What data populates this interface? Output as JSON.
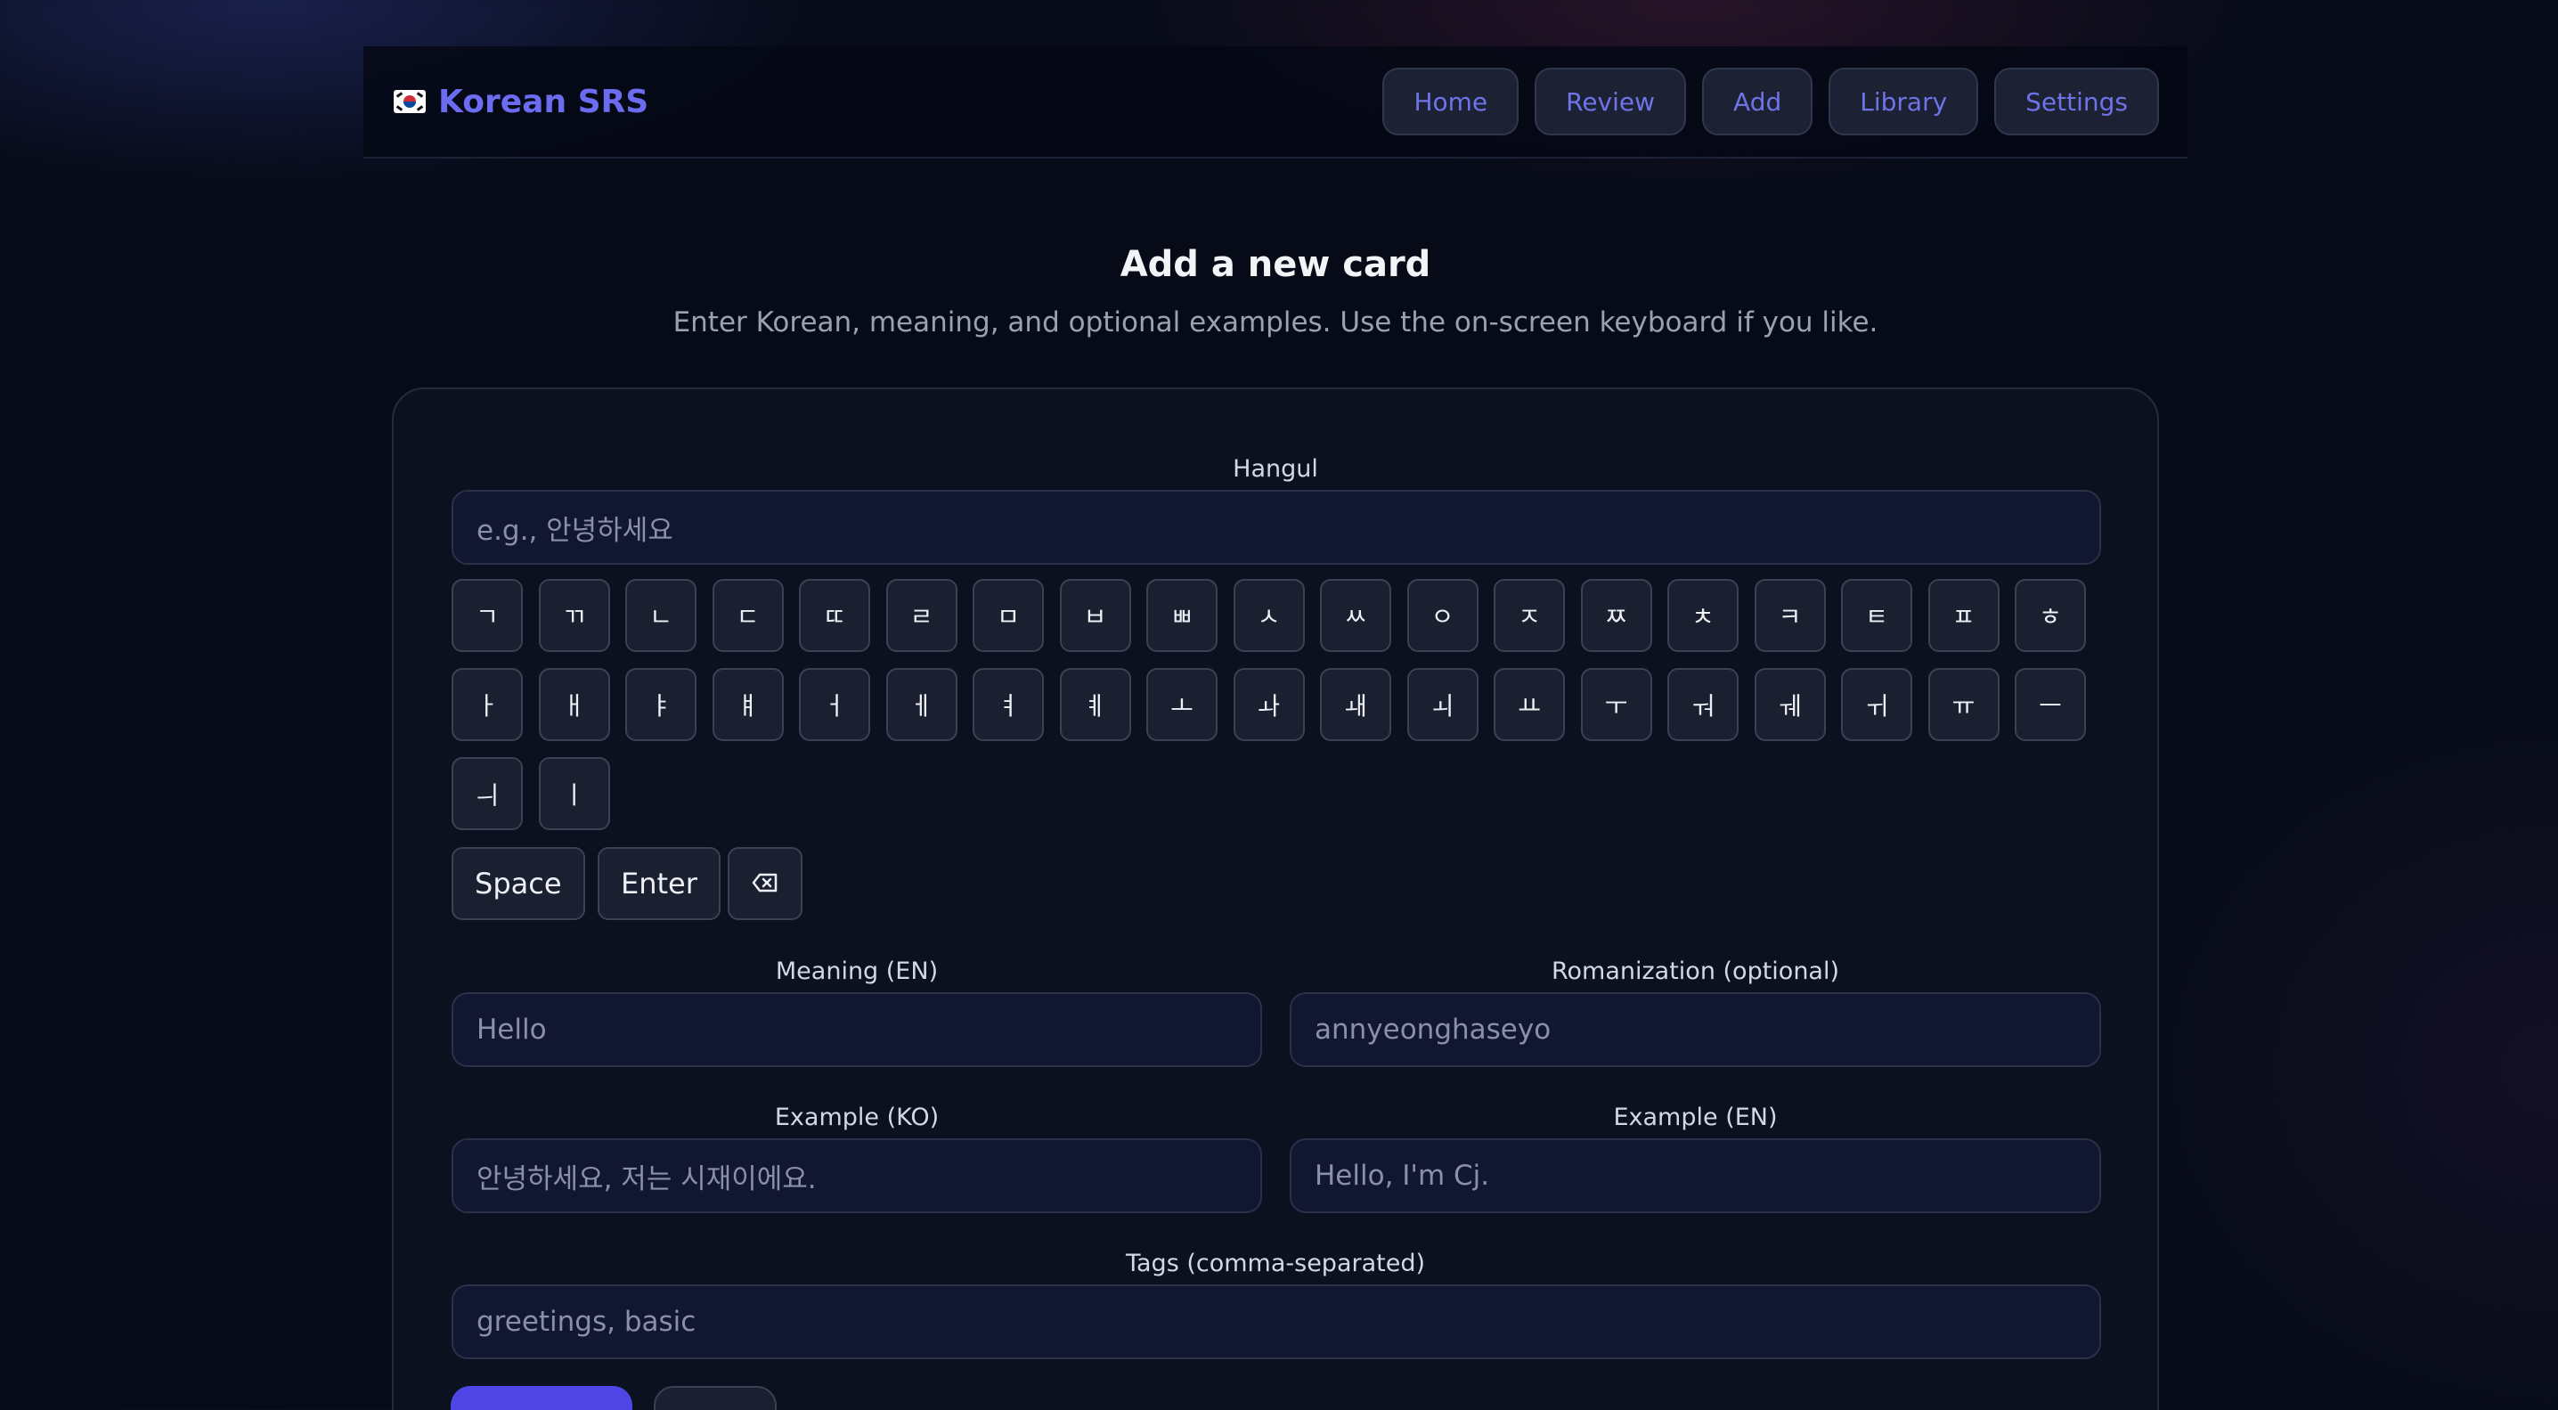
{
  "nav": {
    "brand": "Korean SRS",
    "links": [
      "Home",
      "Review",
      "Add",
      "Library",
      "Settings"
    ]
  },
  "page": {
    "title": "Add a new card",
    "subtitle": "Enter Korean, meaning, and optional examples. Use the on-screen keyboard if you like."
  },
  "form": {
    "hangul": {
      "label": "Hangul",
      "placeholder": "e.g., 안녕하세요"
    },
    "keyboard": {
      "row1": [
        "ㄱ",
        "ㄲ",
        "ㄴ",
        "ㄷ",
        "ㄸ",
        "ㄹ",
        "ㅁ",
        "ㅂ",
        "ㅃ",
        "ㅅ",
        "ㅆ",
        "ㅇ",
        "ㅈ",
        "ㅉ",
        "ㅊ",
        "ㅋ",
        "ㅌ",
        "ㅍ",
        "ㅎ"
      ],
      "row2": [
        "ㅏ",
        "ㅐ",
        "ㅑ",
        "ㅒ",
        "ㅓ",
        "ㅔ",
        "ㅕ",
        "ㅖ",
        "ㅗ",
        "ㅘ",
        "ㅙ",
        "ㅚ",
        "ㅛ",
        "ㅜ",
        "ㅝ",
        "ㅞ",
        "ㅟ",
        "ㅠ",
        "ㅡ"
      ],
      "row3": [
        "ㅢ",
        "ㅣ"
      ],
      "space": "Space",
      "enter": "Enter",
      "backspace_icon": "backspace-icon"
    },
    "meaning": {
      "label": "Meaning (EN)",
      "placeholder": "Hello"
    },
    "romanization": {
      "label": "Romanization (optional)",
      "placeholder": "annyeonghaseyo"
    },
    "example_ko": {
      "label": "Example (KO)",
      "placeholder": "안녕하세요, 저는 시재이에요."
    },
    "example_en": {
      "label": "Example (EN)",
      "placeholder": "Hello, I'm Cj."
    },
    "tags": {
      "label": "Tags (comma-separated)",
      "placeholder": "greetings, basic"
    }
  },
  "colors": {
    "accent": "#6b6cf0",
    "primary_button": "#4f46e5",
    "background": "#070b18"
  }
}
